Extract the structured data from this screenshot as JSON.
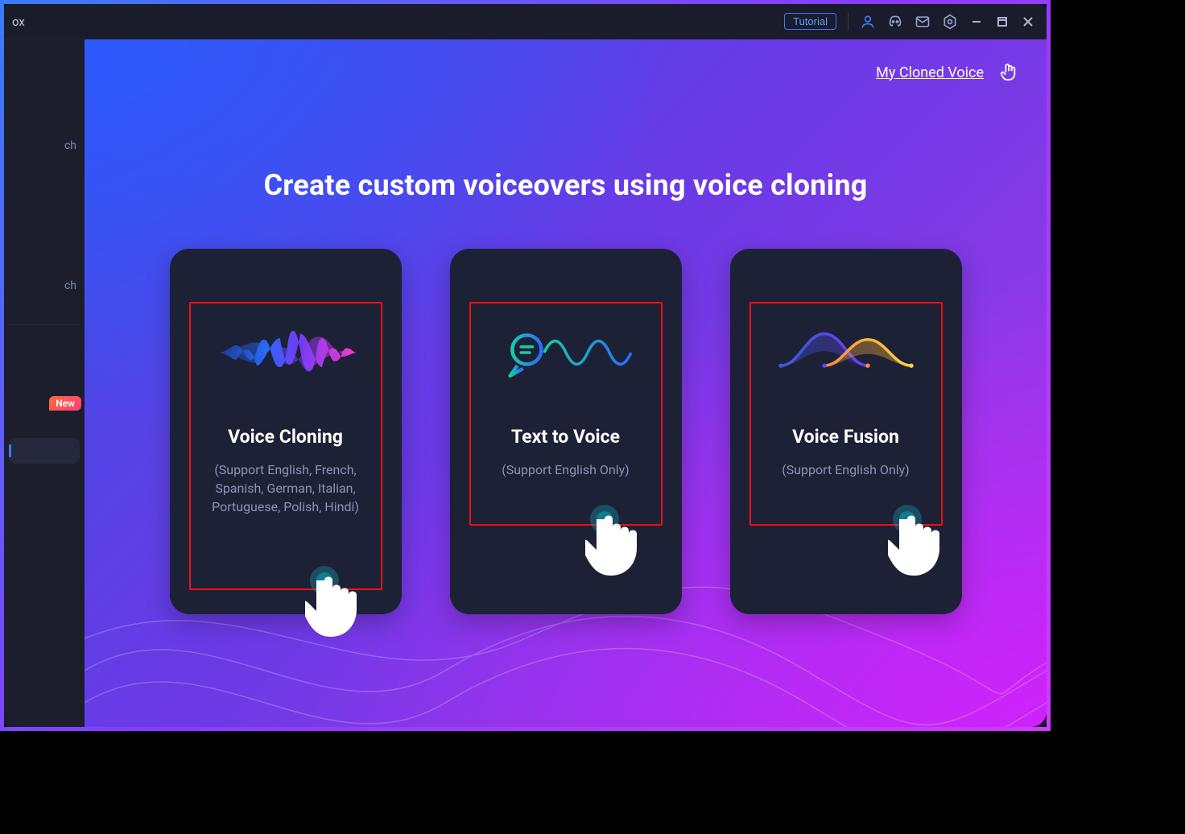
{
  "titlebar": {
    "appTitleFragment": "ox",
    "tutorialLabel": "Tutorial"
  },
  "sidebar": {
    "items": [
      {
        "labelFragment": "ch"
      },
      {
        "labelFragment": "ch"
      },
      {
        "labelFragment": ""
      }
    ],
    "newBadge": "New"
  },
  "toplinks": {
    "myClonedVoice": "My Cloned Voice"
  },
  "headline": "Create custom voiceovers using voice cloning",
  "cards": [
    {
      "title": "Voice Cloning",
      "subtitle": "(Support English, French, Spanish, German, Italian, Portuguese, Polish, Hindi)"
    },
    {
      "title": "Text to Voice",
      "subtitle": "(Support English Only)"
    },
    {
      "title": "Voice Fusion",
      "subtitle": "(Support English Only)"
    }
  ]
}
